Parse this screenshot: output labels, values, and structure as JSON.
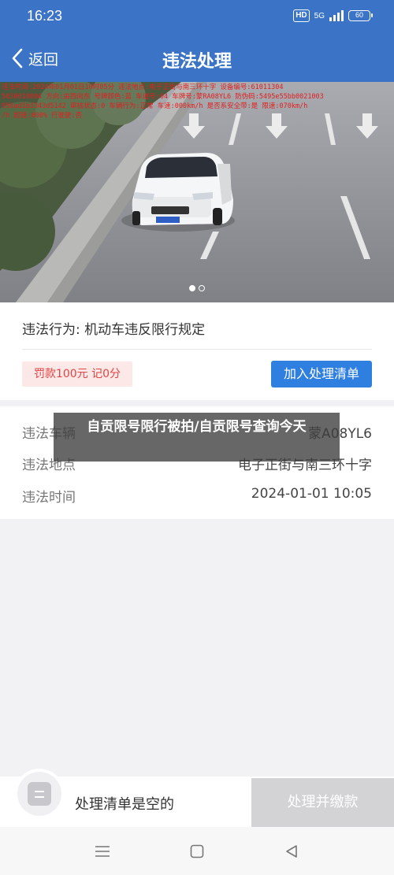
{
  "status_bar": {
    "time": "16:23",
    "hd": "HD",
    "network": "5G",
    "battery": "60"
  },
  "nav": {
    "back_label": "返回",
    "title": "违法处理"
  },
  "photo": {
    "overlay_lines": [
      "违法时间:2024年01月01日10时05分 违法地点:电子正街与南三环十字 设备编号:61011304",
      "5030010004 方向:由西向东 号牌颜色:蓝 车道号:04 车牌号:蒙RA08YL6 防伪码:5495e55bb0021003",
      "956ad1b3343d5142 审核状态:0 车辆行为:正常 车速:000km/h 是否系安全带:是 限速:070km/h",
      "/h 超速:000% 行驶驶:否"
    ],
    "slide_count": 2,
    "active_slide": 0
  },
  "violation": {
    "behavior_label": "违法行为:",
    "behavior_value": "机动车违反限行规定",
    "fine_text": "罚款100元 记0分",
    "add_button": "加入处理清单"
  },
  "details": [
    {
      "label": "违法车辆",
      "value": "蒙A08YL6"
    },
    {
      "label": "违法地点",
      "value": "电子正街与南三环十字"
    },
    {
      "label": "违法时间",
      "value": "2024-01-01 10:05"
    }
  ],
  "banner": {
    "text": "自贡限号限行被拍/自贡限号查询今天"
  },
  "bottom": {
    "empty_text": "处理清单是空的",
    "pay_button": "处理并缴款"
  },
  "colors": {
    "primary": "#3b73c6",
    "button_blue": "#2f7fe0",
    "fine_red": "#e04444",
    "overlay_red": "#e02020"
  }
}
